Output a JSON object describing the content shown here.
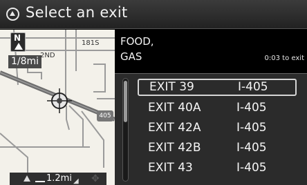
{
  "header": {
    "title": "Select an exit",
    "back_icon": "back-circle-icon"
  },
  "map": {
    "north_label": "N",
    "scale_top": "1/8mi",
    "label_181": "181S",
    "label_2nd": "2ND",
    "shield_405": "405",
    "scale_bottom": "1.2mi",
    "colors": {
      "background": "#f3f1ea",
      "highway": "#6e6e6e",
      "road": "#9a9a9a"
    }
  },
  "panel": {
    "category_line1": "FOOD,",
    "category_line2": "GAS",
    "eta": "0:03 to exit",
    "exits": [
      {
        "exit": "EXIT 39",
        "highway": "I-405",
        "selected": true
      },
      {
        "exit": "EXIT 40A",
        "highway": "I-405",
        "selected": false
      },
      {
        "exit": "EXIT 42A",
        "highway": "I-405",
        "selected": false
      },
      {
        "exit": "EXIT 42B",
        "highway": "I-405",
        "selected": false
      },
      {
        "exit": "EXIT 43",
        "highway": "I-405",
        "selected": false
      }
    ]
  }
}
